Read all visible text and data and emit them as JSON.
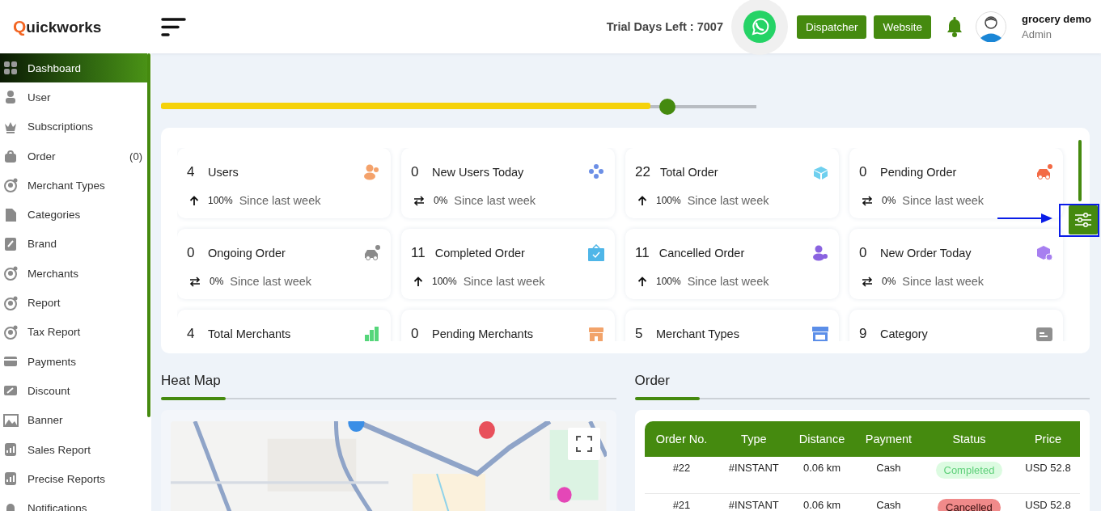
{
  "logo": {
    "first": "Q",
    "rest": "uickworks"
  },
  "sidebar": {
    "items": [
      {
        "label": "Dashboard",
        "selected": true
      },
      {
        "label": "User",
        "selected": false
      },
      {
        "label": "Subscriptions",
        "selected": false
      },
      {
        "label": "Order",
        "count": "(0)",
        "selected": false
      },
      {
        "label": "Merchant Types",
        "selected": false
      },
      {
        "label": "Categories",
        "selected": false
      },
      {
        "label": "Brand",
        "selected": false
      },
      {
        "label": "Merchants",
        "selected": false
      },
      {
        "label": "Report",
        "selected": false
      },
      {
        "label": "Tax Report",
        "selected": false
      },
      {
        "label": "Payments",
        "selected": false
      },
      {
        "label": "Discount",
        "selected": false
      },
      {
        "label": "Banner",
        "selected": false
      },
      {
        "label": "Sales Report",
        "selected": false
      },
      {
        "label": "Precise Reports",
        "selected": false
      },
      {
        "label": "Notifications",
        "selected": false
      }
    ]
  },
  "header": {
    "trial": "Trial Days Left : 7007",
    "buttons": [
      "Dispatcher",
      "Website"
    ],
    "user": {
      "name": "grocery demo",
      "role": "Admin"
    }
  },
  "usage": {
    "level": 0.85
  },
  "stats": [
    {
      "value": "4",
      "label": "Users",
      "color": "#f4a26b",
      "kind": "up",
      "percent": "100%",
      "since": "Since last week"
    },
    {
      "value": "0",
      "label": "New Users Today",
      "color": "#6c8fe6",
      "kind": "flat",
      "percent": "0%",
      "since": "Since last week"
    },
    {
      "value": "22",
      "label": "Total Order",
      "color": "#6fd0ef",
      "kind": "up",
      "percent": "100%",
      "since": "Since last week"
    },
    {
      "value": "0",
      "label": "Pending Order",
      "color": "#f36a45",
      "kind": "flat",
      "percent": "0%",
      "since": "Since last week"
    },
    {
      "value": "0",
      "label": "Ongoing Order",
      "color": "#8a8a8a",
      "kind": "flat",
      "percent": "0%",
      "since": "Since last week"
    },
    {
      "value": "11",
      "label": "Completed Order",
      "color": "#4fb6e8",
      "kind": "up",
      "percent": "100%",
      "since": "Since last week"
    },
    {
      "value": "11",
      "label": "Cancelled Order",
      "color": "#8a63e0",
      "kind": "up",
      "percent": "100%",
      "since": "Since last week"
    },
    {
      "value": "0",
      "label": "New Order Today",
      "color": "#a77ff0",
      "kind": "flat",
      "percent": "0%",
      "since": "Since last week"
    },
    {
      "value": "4",
      "label": "Total Merchants",
      "color": "#55d67a",
      "kind": "plain"
    },
    {
      "value": "0",
      "label": "Pending Merchants",
      "color": "#f2a36a",
      "kind": "plain"
    },
    {
      "value": "5",
      "label": "Merchant Types",
      "color": "#5b8ee8",
      "kind": "plain"
    },
    {
      "value": "9",
      "label": "Category",
      "color": "#8f8f8f",
      "kind": "plain"
    }
  ],
  "heat_map": {
    "title": "Heat Map"
  },
  "order": {
    "title": "Order",
    "table": {
      "columns": [
        "Order No.",
        "Type",
        "Distance",
        "Payment",
        "Status",
        "Price"
      ],
      "rows": [
        {
          "cells": [
            "#22",
            "#INSTANT",
            "0.06 km",
            "Cash"
          ],
          "status": "Completed",
          "kind": "completed",
          "price": "USD 52.8"
        },
        {
          "cells": [
            "#21",
            "#INSTANT",
            "0.06 km",
            "Cash"
          ],
          "status": "Cancelled",
          "kind": "cancelled",
          "price": "USD 52.8"
        }
      ]
    }
  }
}
